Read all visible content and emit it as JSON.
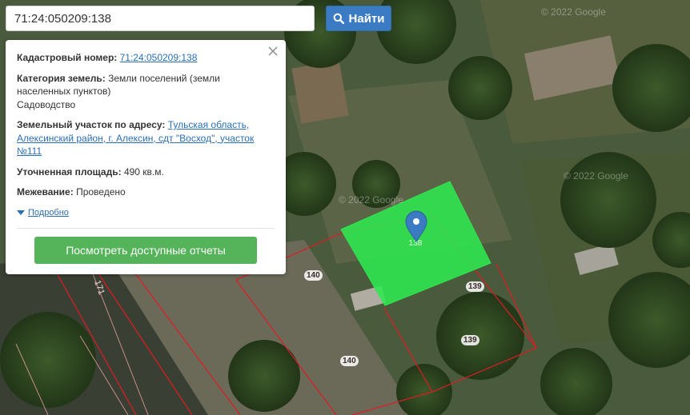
{
  "search": {
    "value": "71:24:050209:138",
    "button_label": "Найти"
  },
  "popup": {
    "cadastral_label": "Кадастровый номер:",
    "cadastral_value": "71:24:050209:138",
    "category_label": "Категория земель:",
    "category_value": "Земли поселений (земли населенных пунктов)",
    "usage_value": "Садоводство",
    "address_label": "Земельный участок по адресу:",
    "address_value": "Тульская область, Алексинский район, г. Алексин, сдт \"Восход\", участок №111",
    "area_label": "Уточненная площадь:",
    "area_value": "490 кв.м.",
    "survey_label": "Межевание:",
    "survey_value": "Проведено",
    "more_label": "Подробно",
    "reports_button": "Посмотреть доступные отчеты"
  },
  "map": {
    "parcel_labels": [
      "140",
      "139",
      "139",
      "140"
    ],
    "selected_label": "138",
    "side_label": "171",
    "watermarks": [
      "© 2022 Google",
      "© 2022 Google",
      "© 2022 Google"
    ],
    "selected_color": "#2ee84f",
    "boundary_color": "#e11b22",
    "marker_color": "#3a7bc3"
  }
}
